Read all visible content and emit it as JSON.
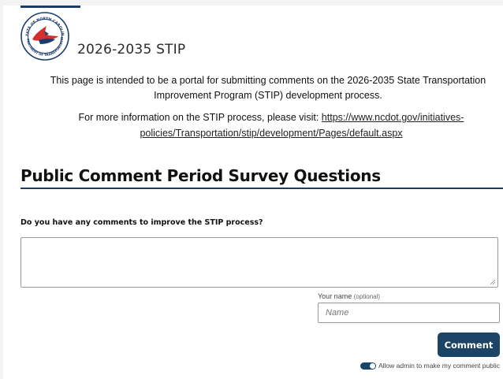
{
  "header": {
    "program_title": "2026-2035 STIP",
    "logo_top_text": "STATE OF NORTH CAROLINA",
    "logo_bottom_text": "DEPARTMENT OF TRANSPORTATION"
  },
  "intro": {
    "text": "This page is intended to be a portal for submitting comments on the 2026-2035 State Transportation Improvement Program (STIP) development process.",
    "more_info_prefix": "For more information on the STIP process, please visit:",
    "link_text": "https://www.ncdot.gov/initiatives-policies/Transportation/stip/development/Pages/default.aspx"
  },
  "survey": {
    "section_title": "Public Comment Period Survey Questions",
    "question": "Do you have any comments to improve the STIP process?",
    "comment_value": "",
    "name_label": "Your name",
    "name_optional": "(optional)",
    "name_placeholder": "Name",
    "comment_button": "Comment",
    "toggle_label": "Allow admin to make my comment public"
  },
  "colors": {
    "accent": "#1c4466",
    "rule": "#1b3d6d",
    "logo_red": "#d32f2f",
    "logo_blue": "#1b3d6d"
  }
}
